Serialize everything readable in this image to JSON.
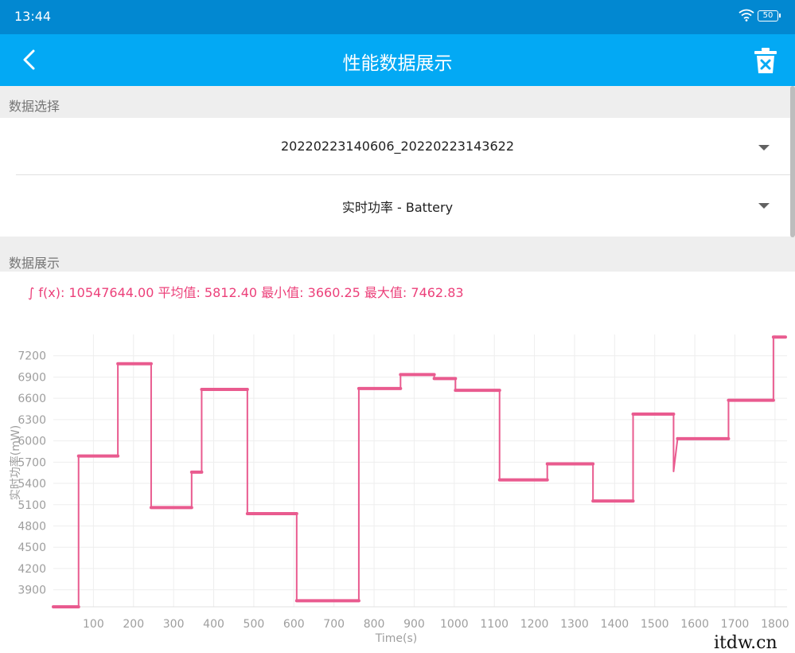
{
  "status_bar": {
    "time": "13:44",
    "battery": "50"
  },
  "app_bar": {
    "title": "性能数据展示"
  },
  "section_select": {
    "label": "数据选择"
  },
  "data_file": {
    "value": "20220223140606_20220223143622"
  },
  "metric": {
    "value": "实时功率 - Battery"
  },
  "section_display": {
    "label": "数据展示"
  },
  "summary": {
    "text": "∫ f(x): 10547644.00 平均值: 5812.40 最小值: 3660.25 最大值: 7462.83"
  },
  "watermark": {
    "text": "itdw.cn"
  },
  "colors": {
    "status_bar": "#0288d1",
    "app_bar": "#03a9f4",
    "accent": "#ec407a",
    "line": "#e95b8f"
  },
  "chart_data": {
    "type": "line",
    "ylabel": "实时功率(mW)",
    "xlabel": "Time(s)",
    "xlim": [
      0,
      1830
    ],
    "ylim": [
      3660,
      7500
    ],
    "x_ticks": [
      100,
      200,
      300,
      400,
      500,
      600,
      700,
      800,
      900,
      1000,
      1100,
      1200,
      1300,
      1400,
      1500,
      1600,
      1700,
      1800
    ],
    "y_ticks": [
      3900,
      4200,
      4500,
      4800,
      5100,
      5400,
      5700,
      6000,
      6300,
      6600,
      6900,
      7200
    ],
    "grid": true,
    "series": [
      {
        "x": [
          0,
          63,
          63,
          161,
          161,
          244,
          244,
          345,
          345,
          370,
          370,
          484,
          484,
          607,
          607,
          762,
          762,
          866,
          866,
          950,
          950,
          1003,
          1003,
          1113,
          1113,
          1232,
          1232,
          1346,
          1346,
          1446,
          1446,
          1547,
          1547,
          1557,
          1557,
          1684,
          1684,
          1796,
          1796,
          1826
        ],
        "y": [
          3660,
          3660,
          5786,
          5786,
          7087,
          7087,
          5060,
          5060,
          5559,
          5559,
          6725,
          6725,
          4973,
          4973,
          3746,
          3746,
          6738,
          6738,
          6935,
          6935,
          6878,
          6878,
          6712,
          6712,
          5449,
          5449,
          5676,
          5676,
          5152,
          5152,
          6377,
          6377,
          5570,
          6031,
          6031,
          6031,
          6572,
          6572,
          7463,
          7463
        ]
      }
    ]
  }
}
